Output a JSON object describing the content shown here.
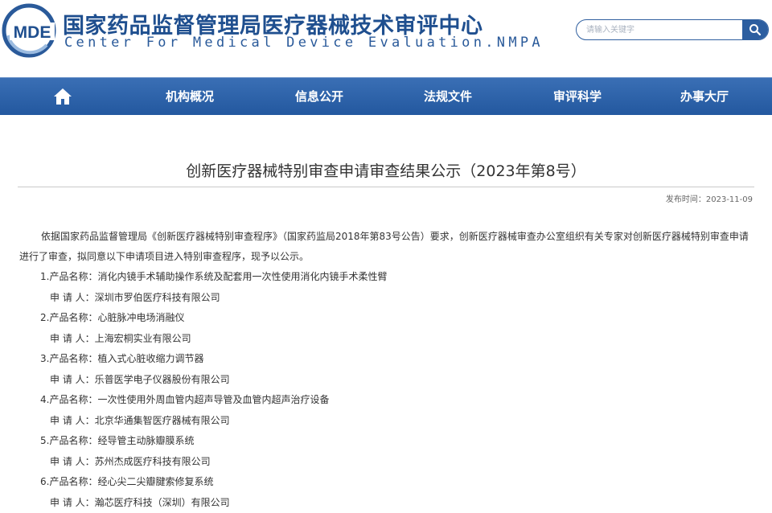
{
  "header": {
    "logo_text": "MDE",
    "title_cn": "国家药品监督管理局医疗器械技术审评中心",
    "title_en": "Center For Medical Device Evaluation.NMPA",
    "search_placeholder": "请输入关键字"
  },
  "colors": {
    "brand_blue": "#2c5ea0",
    "nav_dark": "#23589f"
  },
  "nav": {
    "home_icon": "home-icon",
    "items": [
      {
        "label": "机构概况"
      },
      {
        "label": "信息公开"
      },
      {
        "label": "法规文件"
      },
      {
        "label": "审评科学"
      },
      {
        "label": "办事大厅"
      }
    ]
  },
  "article": {
    "title": "创新医疗器械特别审查申请审查结果公示（2023年第8号）",
    "publish_date": "发布时间：2023-11-09",
    "intro": "依据国家药品监督管理局《创新医疗器械特别审查程序》（国家药监局2018年第83号公告）要求，创新医疗器械审查办公室组织有关专家对创新医疗器械特别审查申请进行了审查，拟同意以下申请项目进入特别审查程序，现予以公示。",
    "items": [
      {
        "product": "1.产品名称：消化内镜手术辅助操作系统及配套用一次性使用消化内镜手术柔性臂",
        "applicant": "申 请 人：深圳市罗伯医疗科技有限公司"
      },
      {
        "product": "2.产品名称：心脏脉冲电场消融仪",
        "applicant": "申 请 人：上海宏桐实业有限公司"
      },
      {
        "product": "3.产品名称：植入式心脏收缩力调节器",
        "applicant": "申 请 人：乐普医学电子仪器股份有限公司"
      },
      {
        "product": "4.产品名称：一次性使用外周血管内超声导管及血管内超声治疗设备",
        "applicant": "申 请 人：北京华通集智医疗器械有限公司"
      },
      {
        "product": "5.产品名称：经导管主动脉瓣膜系统",
        "applicant": "申 请 人：苏州杰成医疗科技有限公司"
      },
      {
        "product": "6.产品名称：经心尖二尖瓣腱索修复系统",
        "applicant": "申 请 人：瀚芯医疗科技（深圳）有限公司"
      }
    ]
  }
}
